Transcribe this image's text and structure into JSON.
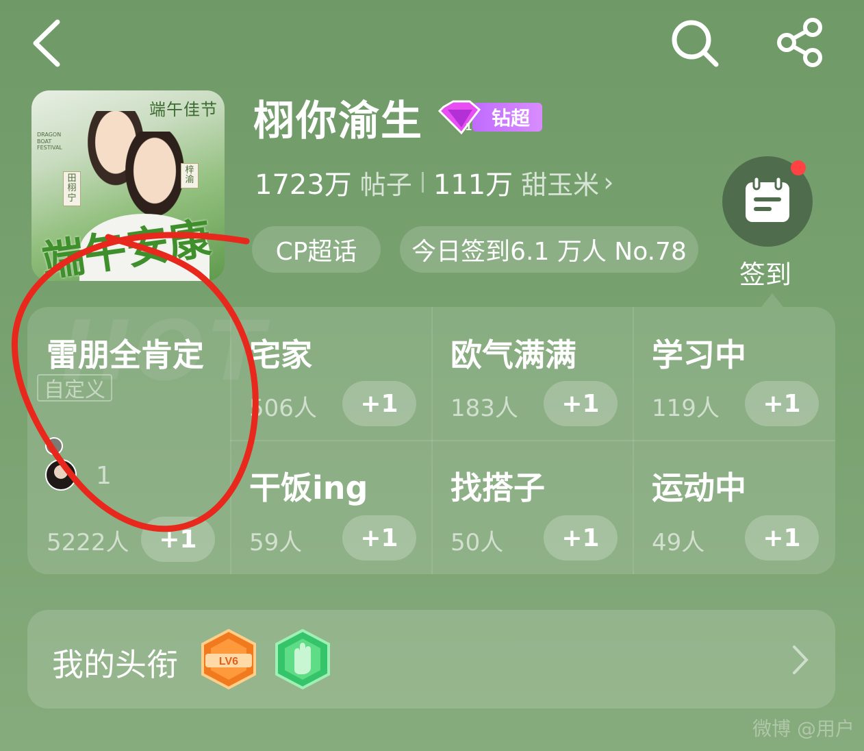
{
  "header": {
    "back_icon": "back-arrow-icon",
    "search_icon": "search-icon",
    "share_icon": "share-icon"
  },
  "cover": {
    "top_text": "端午佳节",
    "big_text": "端午安康",
    "tag_left": "田栩宁",
    "tag_right": "梓渝",
    "tiny_text": "DRAGON BOAT FESTIVAL"
  },
  "topic": {
    "title": "栩你渝生",
    "badge_label": "钻超",
    "posts_count": "1723万",
    "posts_label": "帖子",
    "fans_count": "111万",
    "fans_label": "甜玉米"
  },
  "chips": {
    "cp_label": "CP超话",
    "checkin_label": "今日签到6.1 万人 No.78"
  },
  "signin": {
    "label": "签到",
    "icon": "calendar-icon"
  },
  "moods": [
    {
      "title": "雷朋全肯定",
      "custom_tag": "自定义",
      "count": "5222人",
      "button": "+1",
      "avatar_count": "1"
    },
    {
      "title": "宅家",
      "count": "506人",
      "button": "+1"
    },
    {
      "title": "欧气满满",
      "count": "183人",
      "button": "+1"
    },
    {
      "title": "学习中",
      "count": "119人",
      "button": "+1"
    },
    {
      "title": "干饭ing",
      "count": "59人",
      "button": "+1"
    },
    {
      "title": "找搭子",
      "count": "50人",
      "button": "+1"
    },
    {
      "title": "运动中",
      "count": "49人",
      "button": "+1"
    }
  ],
  "watermark_hot": "HOT",
  "my_title": {
    "label": "我的头衔",
    "badge1": "LV6",
    "badge1_icon": "level-badge-icon",
    "badge2_icon": "waving-hand-badge-icon"
  },
  "watermark": "微博 @用户",
  "colors": {
    "background": "#76a06e",
    "badge_purple": "#c06bff",
    "annotation_red": "#e8281c",
    "notify_dot": "#ff4242"
  }
}
